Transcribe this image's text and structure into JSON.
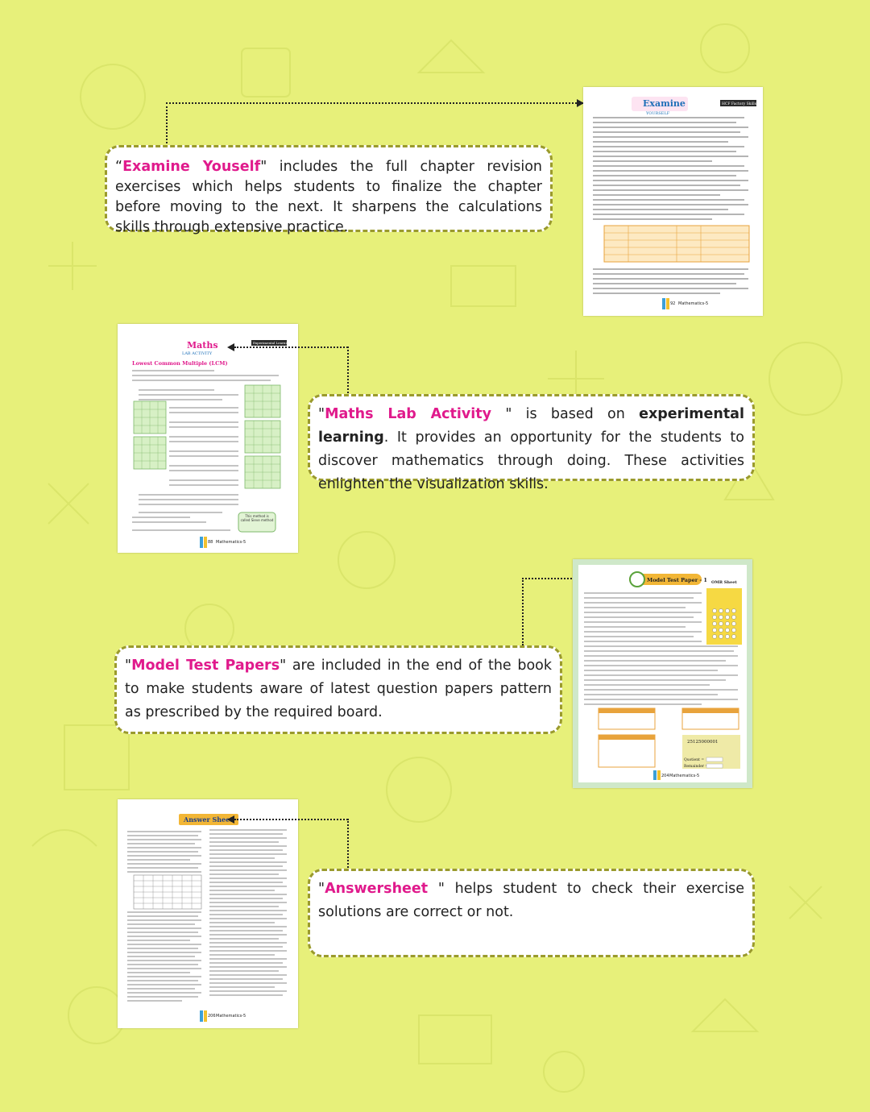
{
  "sections": {
    "examine": {
      "title": "Examine Youself",
      "open_quote": "“",
      "close_quote": "\"",
      "body": " includes the full chapter revision exercises which helps students to  finalize the chapter before moving to the next. It sharpens the calculations skills through extensive practice."
    },
    "lab": {
      "title": "Maths Lab Activity",
      "open_quote": "\"",
      "close_quote": " \"",
      "body_1": " is based on ",
      "bold": "experimental learning",
      "body_2": ". It provides an opportunity for the students to discover mathematics through doing. These activities enlighten the visualization skills."
    },
    "model": {
      "title": "Model Test Papers",
      "open_quote": "\"",
      "close_quote": "\"",
      "body": " are included in the end of the book to make students aware of latest question papers pattern as prescribed by the required board."
    },
    "answer": {
      "title": "Answersheet",
      "open_quote": "\"",
      "close_quote": " \"",
      "body": " helps student to check their exercise solutions are correct or not."
    }
  },
  "thumbnails": {
    "examine": {
      "heading": "Examine",
      "subheading": "YOURSELF",
      "tag": "HCF Factory Skills",
      "page": "92",
      "footer": "Mathematics-5"
    },
    "lab": {
      "heading": "Maths",
      "subheading": "LAB ACTIVITY",
      "tag": "Experimental Learning",
      "title": "Lowest Common Multiple (LCM)",
      "page": "88",
      "footer": "Mathematics-5",
      "note": "This method is called Sieve method"
    },
    "model": {
      "heading": "Model Test Paper - 1",
      "omr": "OMR Sheet",
      "page": "204",
      "footer": "Mathematics-5",
      "answer_value": "25125000001",
      "quotient_label": "Quotient =",
      "remainder_label": "Remainder ="
    },
    "answer": {
      "heading": "Answer Sheet",
      "page": "206",
      "footer": "Mathematics-5"
    }
  },
  "colors": {
    "background": "#e7f07a",
    "accent": "#e01a8c",
    "border": "#9a9a2c"
  }
}
